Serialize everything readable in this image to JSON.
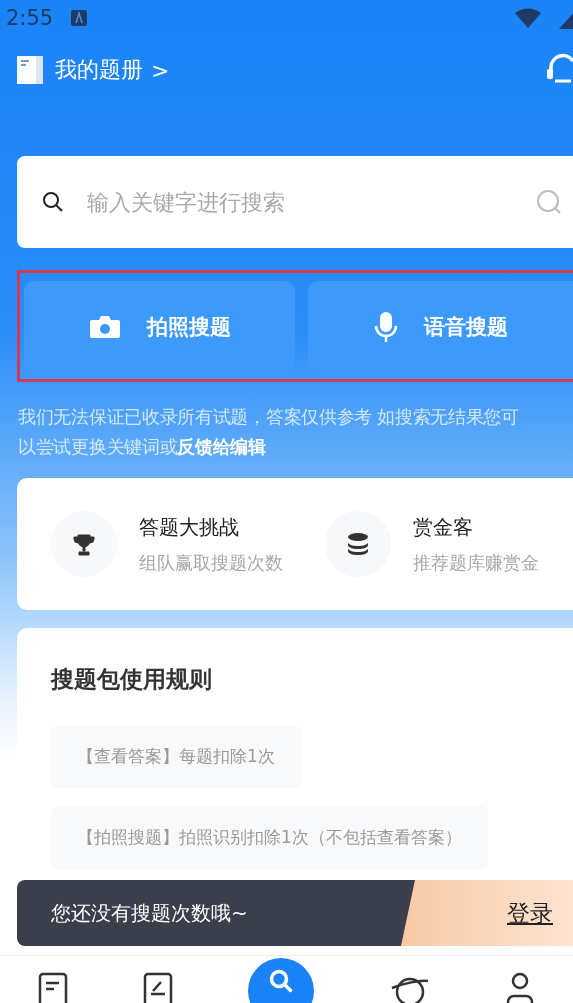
{
  "status_bar": {
    "time": "2:55"
  },
  "header": {
    "title": "我的题册",
    "chevron": ">"
  },
  "search": {
    "placeholder": "输入关键字进行搜索"
  },
  "search_buttons": [
    {
      "kind": "camera",
      "label": "拍照搜题"
    },
    {
      "kind": "mic",
      "label": "语音搜题"
    }
  ],
  "notice": {
    "text": "我们无法保证已收录所有试题，答案仅供参考 如搜索无结果您可以尝试更换关键词或",
    "link": "反馈给编辑"
  },
  "features": [
    {
      "kind": "trophy",
      "title": "答题大挑战",
      "subtitle": "组队赢取搜题次数"
    },
    {
      "kind": "coins",
      "title": "赏金客",
      "subtitle": "推荐题库赚赏金"
    }
  ],
  "rules": {
    "title": "搜题包使用规则",
    "items": [
      "【查看答案】每题扣除1次",
      "【拍照搜题】拍照识别扣除1次（不包括查看答案）"
    ]
  },
  "login_bar": {
    "message": "您还没有搜题次数哦~",
    "button": "登录"
  },
  "bottom_nav": [
    {
      "kind": "doc",
      "selected": false
    },
    {
      "kind": "edit",
      "selected": false
    },
    {
      "kind": "search",
      "selected": true
    },
    {
      "kind": "planet",
      "selected": false
    },
    {
      "kind": "person",
      "selected": false
    }
  ]
}
